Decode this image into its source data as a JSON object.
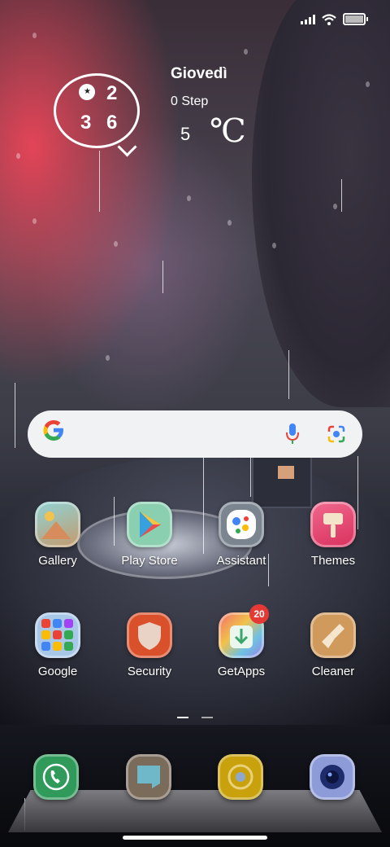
{
  "clock_widget": {
    "digits": [
      "0",
      "2",
      "3",
      "6"
    ]
  },
  "weather": {
    "day": "Giovedì",
    "steps": "0 Step",
    "temperature": "5",
    "unit": "℃"
  },
  "search_bar": {
    "logo": "G",
    "icons": [
      "mic-icon",
      "lens-icon"
    ]
  },
  "apps": [
    {
      "label": "Gallery",
      "icon": "gallery-icon"
    },
    {
      "label": "Play Store",
      "icon": "play-store-icon"
    },
    {
      "label": "Assistant",
      "icon": "assistant-icon"
    },
    {
      "label": "Themes",
      "icon": "themes-icon"
    },
    {
      "label": "Google",
      "icon": "google-folder-icon"
    },
    {
      "label": "Security",
      "icon": "security-icon"
    },
    {
      "label": "GetApps",
      "icon": "getapps-icon",
      "badge": "20"
    },
    {
      "label": "Cleaner",
      "icon": "cleaner-icon"
    }
  ],
  "dock": [
    "phone-icon",
    "messages-icon",
    "chrome-icon",
    "camera-icon"
  ],
  "colors": {
    "badge": "#e53935",
    "search_bg": "#f1f2f4",
    "google_blue": "#4285f4"
  }
}
